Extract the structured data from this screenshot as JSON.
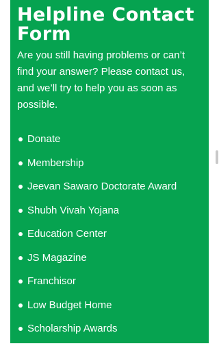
{
  "form": {
    "title": "Helpline Contact Form",
    "intro": "Are you still having problems or can’t find your answer? Please contact us, and we’ll try to help you as soon as possible."
  },
  "links": [
    {
      "label": "Donate"
    },
    {
      "label": "Membership"
    },
    {
      "label": "Jeevan Sawaro Doctorate Award"
    },
    {
      "label": "Shubh Vivah Yojana"
    },
    {
      "label": "Education Center"
    },
    {
      "label": "JS Magazine"
    },
    {
      "label": "Franchisor"
    },
    {
      "label": "Low Budget Home"
    },
    {
      "label": "Scholarship Awards"
    }
  ],
  "colors": {
    "panel_background": "#06a350",
    "text": "#ffffff"
  }
}
